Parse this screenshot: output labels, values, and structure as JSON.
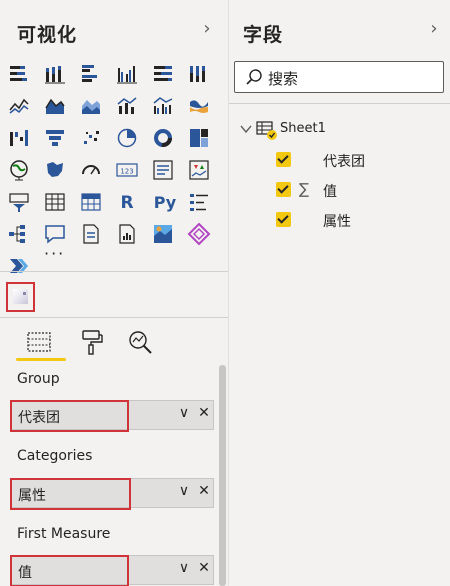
{
  "visualizations": {
    "title": "可视化",
    "collapse_icon": "chevron-right-icon",
    "icons": [
      "stacked-bar-chart-icon",
      "stacked-column-chart-icon",
      "clustered-bar-chart-icon",
      "clustered-column-chart-icon",
      "100-stacked-bar-chart-icon",
      "100-stacked-column-chart-icon",
      "line-chart-icon",
      "area-chart-icon",
      "stacked-area-chart-icon",
      "line-and-stacked-column-chart-icon",
      "line-and-clustered-column-chart-icon",
      "ribbon-chart-icon",
      "waterfall-chart-icon",
      "funnel-chart-icon",
      "scatter-chart-icon",
      "pie-chart-icon",
      "donut-chart-icon",
      "treemap-icon",
      "map-icon",
      "filled-map-icon",
      "gauge-icon",
      "card-icon",
      "multi-row-card-icon",
      "kpi-icon",
      "slicer-icon",
      "table-icon",
      "matrix-icon",
      "r-script-visual-icon",
      "python-visual-icon",
      "key-influencers-icon",
      "decomposition-tree-icon",
      "qa-icon",
      "smart-narrative-icon",
      "paginated-report-icon",
      "arcgis-map-icon",
      "power-apps-icon",
      "power-automate-icon"
    ],
    "r_label": "R",
    "py_label": "Py",
    "card_label": "123",
    "more_label": "···",
    "custom_visual_icon": "custom-visual-icon"
  },
  "tabs": [
    {
      "name": "fields-tab-icon",
      "active": true
    },
    {
      "name": "format-tab-icon",
      "active": false
    },
    {
      "name": "analytics-tab-icon",
      "active": false
    }
  ],
  "wells": [
    {
      "label": "Group",
      "value": "代表团"
    },
    {
      "label": "Categories",
      "value": "属性"
    },
    {
      "label": "First Measure",
      "value": "值"
    }
  ],
  "fields_pane": {
    "title": "字段",
    "search_placeholder": "搜索",
    "table_name": "Sheet1",
    "fields": [
      {
        "label": "代表团",
        "checked": true,
        "sigma": ""
      },
      {
        "label": "值",
        "checked": true,
        "sigma": "∑"
      },
      {
        "label": "属性",
        "checked": true,
        "sigma": ""
      }
    ]
  },
  "colors": {
    "accent_yellow": "#f2c811",
    "highlight_red": "#d13438",
    "icon_blue": "#2b579a",
    "icon_teal": "#118dff"
  }
}
